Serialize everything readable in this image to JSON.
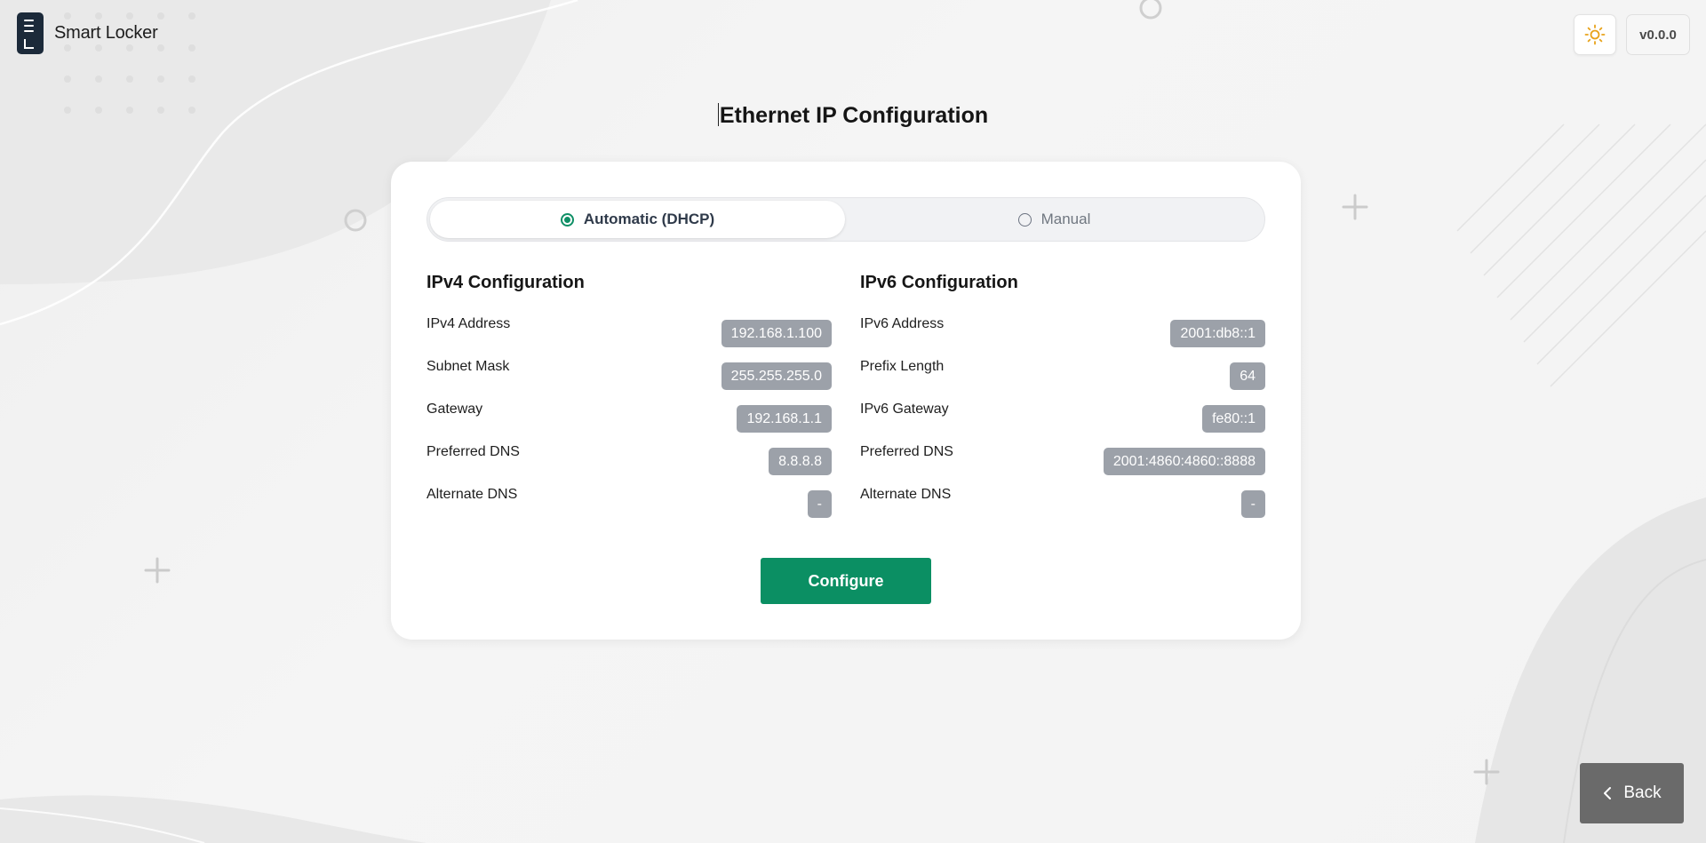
{
  "app": {
    "name": "Smart Locker",
    "version": "v0.0.0"
  },
  "icons": {
    "logo": "locker-logo-icon",
    "theme": "sun-icon",
    "back": "chevron-left-icon"
  },
  "colors": {
    "accent": "#0b8f63",
    "theme_icon": "#e8a21a",
    "value_badge": "#9ca1a9",
    "back_button": "#6a6a6a"
  },
  "page": {
    "title": "Ethernet IP Configuration"
  },
  "mode": {
    "options": [
      {
        "label": "Automatic (DHCP)",
        "selected": true
      },
      {
        "label": "Manual",
        "selected": false
      }
    ]
  },
  "ipv4": {
    "title": "IPv4 Configuration",
    "rows": [
      {
        "label": "IPv4 Address",
        "value": "192.168.1.100"
      },
      {
        "label": "Subnet Mask",
        "value": "255.255.255.0"
      },
      {
        "label": "Gateway",
        "value": "192.168.1.1"
      },
      {
        "label": "Preferred DNS",
        "value": "8.8.8.8"
      },
      {
        "label": "Alternate DNS",
        "value": "-"
      }
    ]
  },
  "ipv6": {
    "title": "IPv6 Configuration",
    "rows": [
      {
        "label": "IPv6 Address",
        "value": "2001:db8::1"
      },
      {
        "label": "Prefix Length",
        "value": "64"
      },
      {
        "label": "IPv6 Gateway",
        "value": "fe80::1"
      },
      {
        "label": "Preferred DNS",
        "value": "2001:4860:4860::8888"
      },
      {
        "label": "Alternate DNS",
        "value": "-"
      }
    ]
  },
  "actions": {
    "configure_label": "Configure",
    "back_label": "Back"
  }
}
